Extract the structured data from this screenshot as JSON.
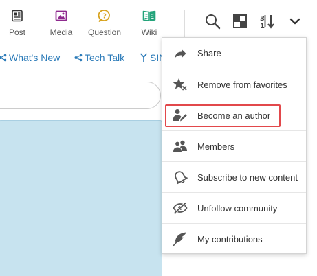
{
  "toolbar": {
    "create": [
      {
        "label": "Post",
        "icon": "post-icon"
      },
      {
        "label": "Media",
        "icon": "media-icon"
      },
      {
        "label": "Question",
        "icon": "question-icon"
      },
      {
        "label": "Wiki",
        "icon": "wiki-icon"
      }
    ],
    "actions": [
      "search-icon",
      "layout-icon",
      "sort-icon",
      "chevron-down-icon"
    ]
  },
  "nav_links": [
    {
      "label": "What's New",
      "icon": "tag-icon"
    },
    {
      "label": "Tech Talk",
      "icon": "tag-icon"
    },
    {
      "label": "SIN",
      "icon": "fork-icon"
    }
  ],
  "menu": {
    "items": [
      {
        "label": "Share",
        "icon": "share-icon"
      },
      {
        "label": "Remove from favorites",
        "icon": "star-remove-icon"
      },
      {
        "label": "Become an author",
        "icon": "author-icon",
        "highlighted": true
      },
      {
        "label": "Members",
        "icon": "members-icon"
      },
      {
        "label": "Subscribe to new content",
        "icon": "bell-icon"
      },
      {
        "label": "Unfollow community",
        "icon": "eye-off-icon"
      },
      {
        "label": "My contributions",
        "icon": "feather-icon"
      }
    ]
  },
  "colors": {
    "link": "#2a7ab8",
    "media_accent": "#8e2a8e",
    "question_accent": "#d8a31f",
    "wiki_accent": "#23a37a",
    "highlight_border": "#e2484b",
    "content_panel": "#c7e3ef"
  }
}
